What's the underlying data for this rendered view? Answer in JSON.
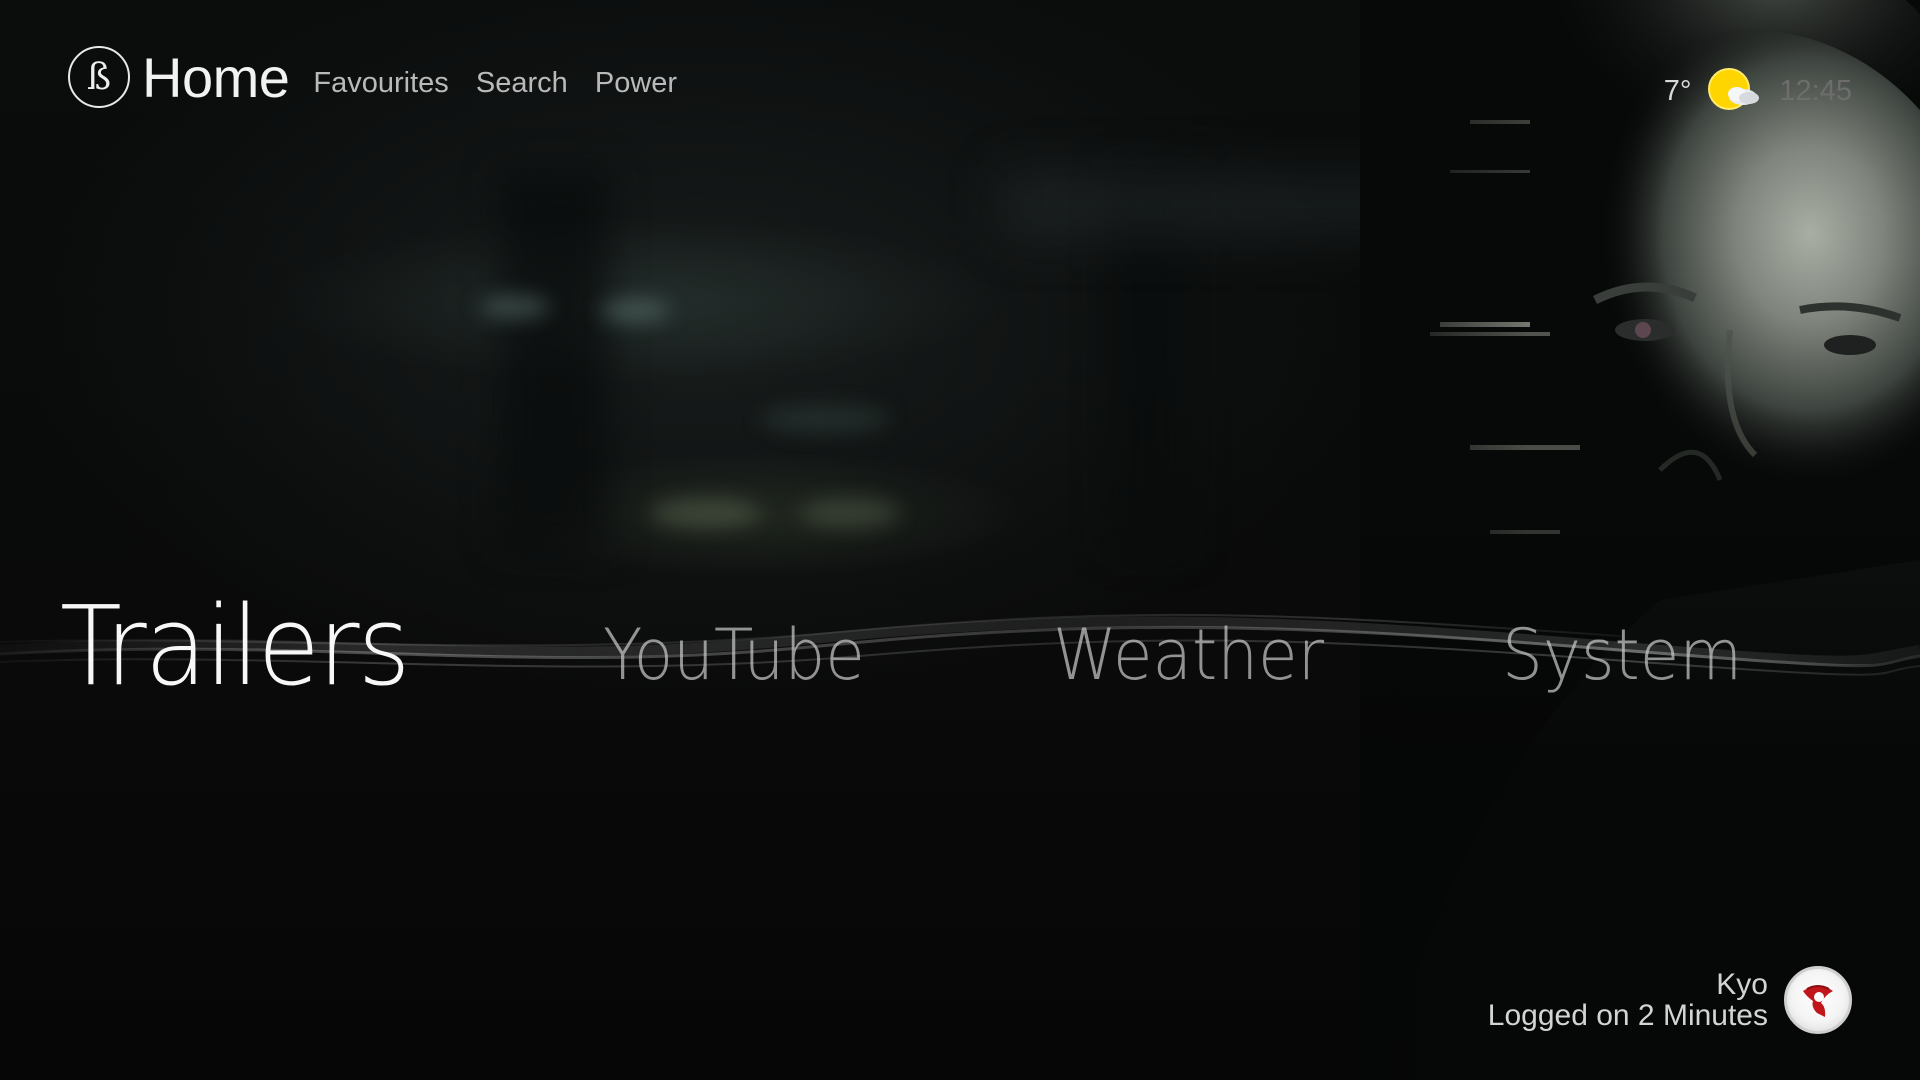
{
  "header": {
    "logo_glyph": "ß",
    "title": "Home",
    "nav": [
      {
        "label": "Favourites"
      },
      {
        "label": "Search"
      },
      {
        "label": "Power"
      }
    ]
  },
  "status": {
    "temperature": "7°",
    "weather_icon": "partly-cloudy-icon",
    "time": "12:45"
  },
  "menu": {
    "items": [
      {
        "label": "Trailers",
        "active": true
      },
      {
        "label": "YouTube",
        "active": false
      },
      {
        "label": "Weather",
        "active": false
      },
      {
        "label": "System",
        "active": false
      }
    ]
  },
  "user": {
    "name": "Kyo",
    "session": "Logged on 2 Minutes",
    "avatar_icon": "user-emblem-icon"
  },
  "colors": {
    "accent_text": "#f7f7f7",
    "nav_text": "#b9b9b9",
    "clock_text": "#6d6d6d",
    "sun": "#ffd500",
    "avatar_emblem": "#c0161c"
  }
}
